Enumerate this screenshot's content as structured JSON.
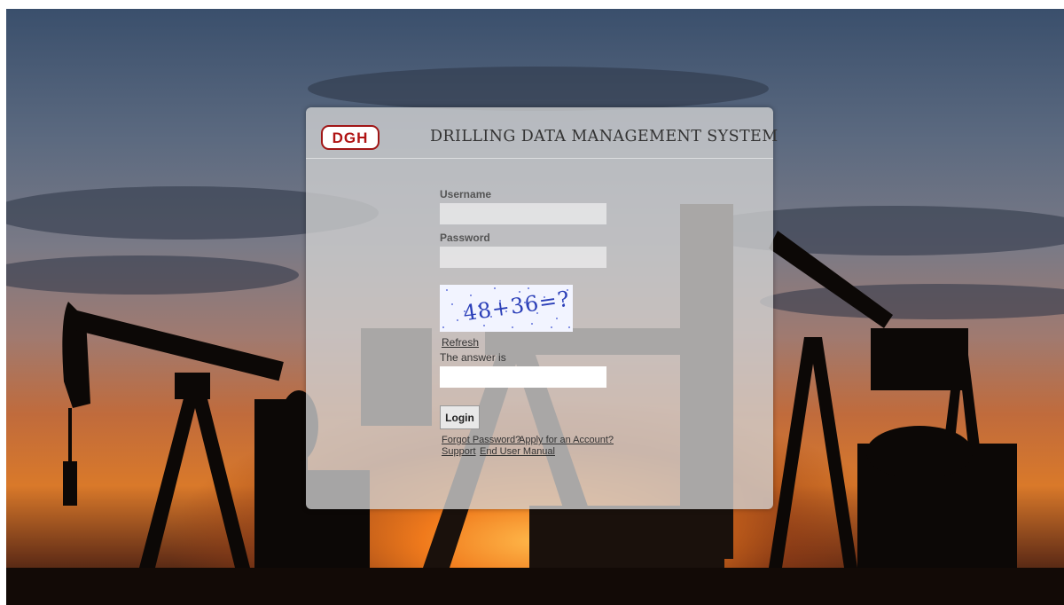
{
  "header": {
    "logo_text": "DGH",
    "title": "DRILLING DATA MANAGEMENT SYSTEM"
  },
  "login_form": {
    "username_label": "Username",
    "username_value": "",
    "password_label": "Password",
    "password_value": "",
    "captcha_text": "48+36=?",
    "refresh_label": "Refresh",
    "answer_label": "The answer is",
    "answer_value": "",
    "login_label": "Login"
  },
  "links": {
    "forgot_password": "Forgot Password?",
    "apply_account": "Apply for an Account?",
    "support": "Support",
    "user_manual": "End User Manual"
  },
  "colors": {
    "logo_red": "#b01414",
    "panel_bg": "rgba(210,210,210,0.78)"
  }
}
